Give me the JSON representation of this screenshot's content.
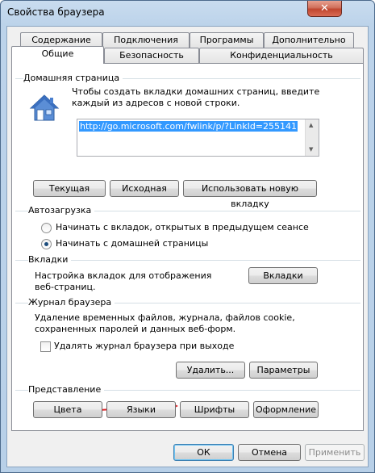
{
  "window": {
    "title": "Свойства браузера",
    "close_symbol": "✕"
  },
  "tabs": {
    "row1": [
      "Содержание",
      "Подключения",
      "Программы",
      "Дополнительно"
    ],
    "row2": [
      "Общие",
      "Безопасность",
      "Конфиденциальность"
    ],
    "active": "Общие"
  },
  "home": {
    "section_label": "Домашняя страница",
    "description_line1": "Чтобы создать вкладки домашних страниц, введите",
    "description_line2": "каждый из адресов с новой строки.",
    "url_value": "http://go.microsoft.com/fwlink/p/?LinkId=255141",
    "buttons": {
      "current": "Текущая",
      "default": "Исходная",
      "new_tab": "Использовать новую вкладку"
    }
  },
  "startup": {
    "section_label": "Автозагрузка",
    "option_tabs": "Начинать с вкладок, открытых в предыдущем сеансе",
    "option_home": "Начинать с домашней страницы",
    "selected": "option_home"
  },
  "tabs_section": {
    "section_label": "Вкладки",
    "description_line1": "Настройка вкладок для отображения",
    "description_line2": "веб-страниц.",
    "button": "Вкладки"
  },
  "history": {
    "section_label": "Журнал браузера",
    "description_line1": "Удаление временных файлов, журнала, файлов cookie,",
    "description_line2": "сохраненных паролей и данных веб-форм.",
    "delete_on_exit_label": "Удалять журнал браузера при выходе",
    "delete_on_exit_checked": false,
    "delete_button": "Удалить...",
    "settings_button": "Параметры"
  },
  "appearance": {
    "section_label": "Представление",
    "buttons": {
      "colors": "Цвета",
      "languages": "Языки",
      "fonts": "Шрифты",
      "accessibility": "Оформление"
    }
  },
  "footer": {
    "ok": "ОК",
    "cancel": "Отмена",
    "apply": "Применить"
  },
  "colors": {
    "annotation_arrow": "#e0252a",
    "selection": "#3399ff",
    "close_button": "#c0462f"
  }
}
